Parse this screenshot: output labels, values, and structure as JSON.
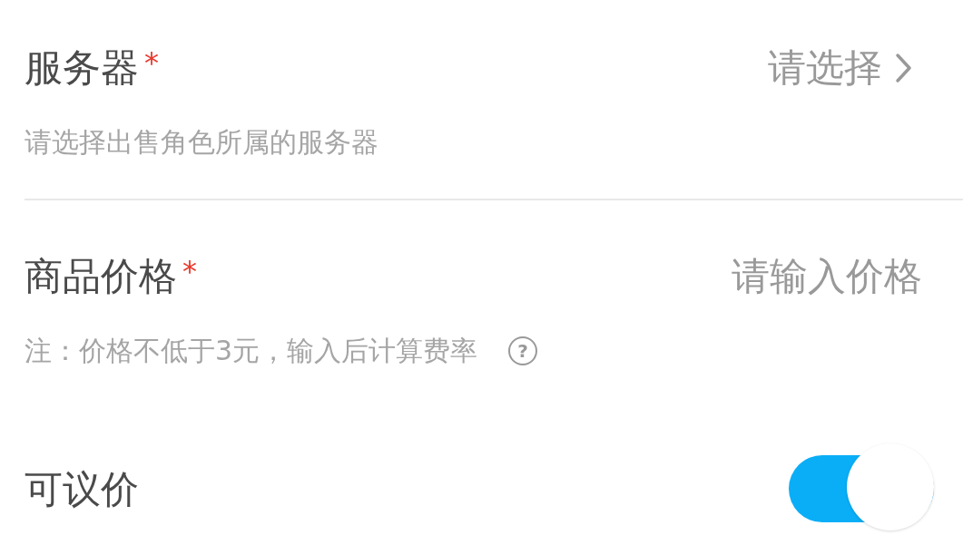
{
  "fields": [
    {
      "kind": "select",
      "label": "服务器",
      "required_mark": "*",
      "value": "请选择",
      "hint": "请选择出售角色所属的服务器",
      "divider": true
    },
    {
      "kind": "input",
      "label": "商品价格",
      "required_mark": "*",
      "placeholder": "请输入价格",
      "hint": "注：价格不低于3元，输入后计算费率",
      "help": "?",
      "divider": false
    },
    {
      "kind": "switch",
      "label": "可议价",
      "on": true,
      "divider": false
    }
  ]
}
